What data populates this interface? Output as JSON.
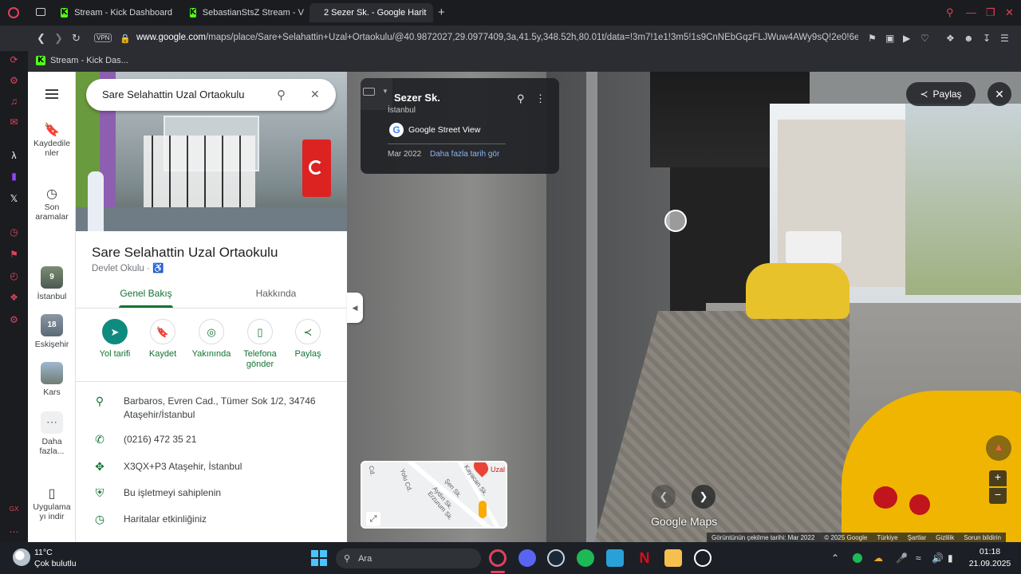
{
  "browser": {
    "tabs": [
      {
        "label": "Stream - Kick Dashboard",
        "active": false
      },
      {
        "label": "SebastianStsZ Stream - V",
        "active": false
      },
      {
        "label": "2 Sezer Sk. - Google Harit",
        "active": true
      }
    ],
    "vpn_label": "VPN",
    "url_host": "www.google.com",
    "url_path": "/maps/place/Sare+Selahattin+Uzal+Ortaokulu/@40.9872027,29.0977409,3a,41.5y,348.52h,80.01t/data=!3m7!1e1!3m5!1s9CnNEbGqzFLJWuw4AWy9sQ!2e0!6e",
    "bookmark": "Stream - Kick Das..."
  },
  "rail": {
    "items": [
      {
        "label": "Kaydedile\nnler",
        "icon": "bookmark-icon"
      },
      {
        "label": "Son\naramalar",
        "icon": "history-icon"
      },
      {
        "label": "İstanbul",
        "thumb": "9"
      },
      {
        "label": "Eskişehir",
        "thumb": "18"
      },
      {
        "label": "Kars",
        "thumb": ""
      },
      {
        "label": "Daha\nfazla...",
        "icon": "more-icon"
      },
      {
        "label": "Uygulama\nyı indir",
        "icon": "phone-icon"
      }
    ]
  },
  "search": {
    "value": "Sare Selahattin Uzal Ortaokulu"
  },
  "place": {
    "title": "Sare Selahattin Uzal Ortaokulu",
    "type": "Devlet Okulu",
    "tabs": [
      "Genel Bakış",
      "Hakkında"
    ],
    "actions": [
      {
        "label": "Yol tarifi"
      },
      {
        "label": "Kaydet"
      },
      {
        "label": "Yakınında"
      },
      {
        "label": "Telefona gönder"
      },
      {
        "label": "Paylaş"
      }
    ],
    "info": {
      "address": "Barbaros, Evren Cad., Tümer Sok 1/2, 34746 Ataşehir/İstanbul",
      "phone": "(0216) 472 35 21",
      "plus_code": "X3QX+P3 Ataşehir, İstanbul",
      "claim": "Bu işletmeyi sahiplenin",
      "activity": "Haritalar etkinliğiniz"
    }
  },
  "streetview": {
    "street": "Sezer Sk.",
    "city": "İstanbul",
    "source": "Google Street View",
    "date": "Mar 2022",
    "history_link": "Daha fazla tarih gör",
    "share_label": "Paylaş",
    "logo": "Google Maps",
    "bottom_bar": [
      "Görüntünün çekilme tarihi: Mar 2022",
      "© 2025 Google",
      "Türkiye",
      "Şartlar",
      "Gizlilik",
      "Sorun bildirin"
    ],
    "minimap_labels": [
      "Cd.",
      "Yolu Cd.",
      "Şen Sk.",
      "Kayacan Sk.",
      "Aydın Sk.",
      "Erzurum Sk.",
      "Uzal"
    ]
  },
  "taskbar": {
    "weather_temp": "11°C",
    "weather_desc": "Çok bulutlu",
    "search_placeholder": "Ara",
    "time": "01:18",
    "date": "21.09.2025"
  },
  "colors": {
    "maps_green": "#137333",
    "action_teal": "#0f8a7e",
    "opera_red": "#e0425b",
    "kick_green": "#53fc18"
  }
}
